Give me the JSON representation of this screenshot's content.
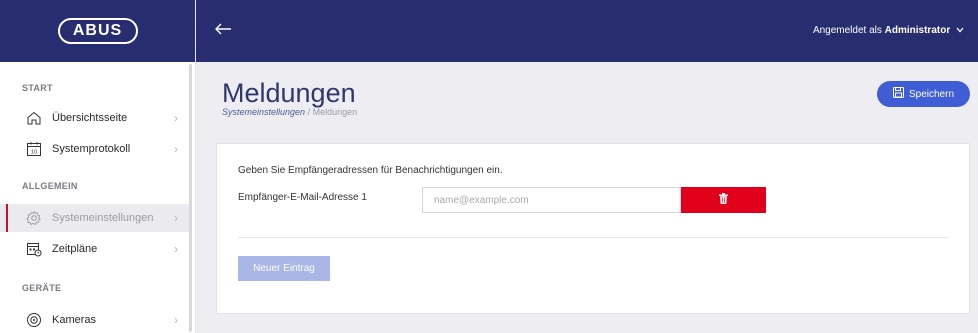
{
  "brand": {
    "logo_text": "ABUS"
  },
  "topbar": {
    "back_icon": "arrow-left-icon",
    "user_prefix": "Angemeldet als",
    "user_name": "Administrator",
    "user_chevron": "⌄"
  },
  "sidebar": {
    "sections": [
      {
        "label": "START"
      },
      {
        "label": "ALLGEMEIN"
      },
      {
        "label": "GERÄTE"
      }
    ],
    "items": [
      {
        "label": "Übersichtsseite",
        "icon": "home-icon"
      },
      {
        "label": "Systemprotokoll",
        "icon": "calendar-icon",
        "icon_text": "10"
      },
      {
        "label": "Systemeinstellungen",
        "icon": "gear-icon",
        "active": true
      },
      {
        "label": "Zeitpläne",
        "icon": "schedule-icon"
      },
      {
        "label": "Kameras",
        "icon": "camera-icon"
      }
    ],
    "chevron": "›"
  },
  "header": {
    "title": "Meldungen",
    "breadcrumb_link": "Systemeinstellungen",
    "breadcrumb_sep": " / ",
    "breadcrumb_current": "Meldungen",
    "save_label": "Speichern"
  },
  "card": {
    "description": "Geben Sie Empfängeradressen für Benachrichtigungen ein.",
    "email_label": "Empfänger-E-Mail-Adresse 1",
    "email_placeholder": "name@example.com",
    "email_value": "",
    "new_entry_label": "Neuer Eintrag"
  },
  "colors": {
    "topbar": "#272d6f",
    "save_button": "#3f5ed6",
    "delete_button": "#e0001b",
    "new_entry_button": "#a9b6e6",
    "active_marker": "#c6132b"
  }
}
